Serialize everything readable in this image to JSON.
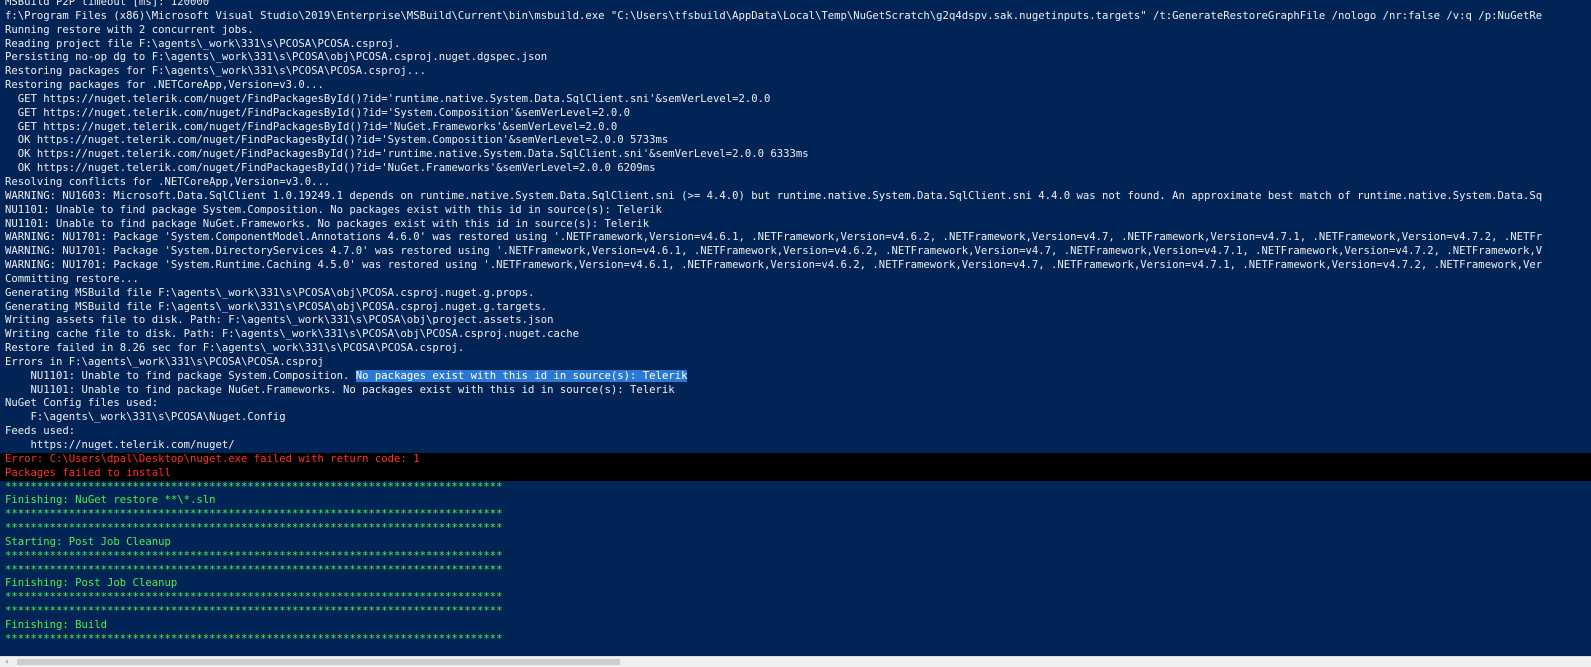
{
  "console": {
    "lines": [
      {
        "kind": "normal",
        "text": "MSBuild P2P timeout [ms]: 120000"
      },
      {
        "kind": "normal",
        "text": "f:\\Program Files (x86)\\Microsoft Visual Studio\\2019\\Enterprise\\MSBuild\\Current\\bin\\msbuild.exe \"C:\\Users\\tfsbuild\\AppData\\Local\\Temp\\NuGetScratch\\g2q4dspv.sak.nugetinputs.targets\" /t:GenerateRestoreGraphFile /nologo /nr:false /v:q /p:NuGetRe"
      },
      {
        "kind": "normal",
        "text": "Running restore with 2 concurrent jobs."
      },
      {
        "kind": "normal",
        "text": "Reading project file F:\\agents\\_work\\331\\s\\PCOSA\\PCOSA.csproj."
      },
      {
        "kind": "normal",
        "text": "Persisting no-op dg to F:\\agents\\_work\\331\\s\\PCOSA\\obj\\PCOSA.csproj.nuget.dgspec.json"
      },
      {
        "kind": "normal",
        "text": "Restoring packages for F:\\agents\\_work\\331\\s\\PCOSA\\PCOSA.csproj..."
      },
      {
        "kind": "normal",
        "text": "Restoring packages for .NETCoreApp,Version=v3.0..."
      },
      {
        "kind": "normal",
        "text": "  GET https://nuget.telerik.com/nuget/FindPackagesById()?id='runtime.native.System.Data.SqlClient.sni'&semVerLevel=2.0.0"
      },
      {
        "kind": "normal",
        "text": "  GET https://nuget.telerik.com/nuget/FindPackagesById()?id='System.Composition'&semVerLevel=2.0.0"
      },
      {
        "kind": "normal",
        "text": "  GET https://nuget.telerik.com/nuget/FindPackagesById()?id='NuGet.Frameworks'&semVerLevel=2.0.0"
      },
      {
        "kind": "normal",
        "text": "  OK https://nuget.telerik.com/nuget/FindPackagesById()?id='System.Composition'&semVerLevel=2.0.0 5733ms"
      },
      {
        "kind": "normal",
        "text": "  OK https://nuget.telerik.com/nuget/FindPackagesById()?id='runtime.native.System.Data.SqlClient.sni'&semVerLevel=2.0.0 6333ms"
      },
      {
        "kind": "normal",
        "text": "  OK https://nuget.telerik.com/nuget/FindPackagesById()?id='NuGet.Frameworks'&semVerLevel=2.0.0 6209ms"
      },
      {
        "kind": "normal",
        "text": "Resolving conflicts for .NETCoreApp,Version=v3.0..."
      },
      {
        "kind": "normal",
        "text": "WARNING: NU1603: Microsoft.Data.SqlClient 1.0.19249.1 depends on runtime.native.System.Data.SqlClient.sni (>= 4.4.0) but runtime.native.System.Data.SqlClient.sni 4.4.0 was not found. An approximate best match of runtime.native.System.Data.Sq"
      },
      {
        "kind": "normal",
        "text": "NU1101: Unable to find package System.Composition. No packages exist with this id in source(s): Telerik"
      },
      {
        "kind": "normal",
        "text": "NU1101: Unable to find package NuGet.Frameworks. No packages exist with this id in source(s): Telerik"
      },
      {
        "kind": "normal",
        "text": "WARNING: NU1701: Package 'System.ComponentModel.Annotations 4.6.0' was restored using '.NETFramework,Version=v4.6.1, .NETFramework,Version=v4.6.2, .NETFramework,Version=v4.7, .NETFramework,Version=v4.7.1, .NETFramework,Version=v4.7.2, .NETFr"
      },
      {
        "kind": "normal",
        "text": "WARNING: NU1701: Package 'System.DirectoryServices 4.7.0' was restored using '.NETFramework,Version=v4.6.1, .NETFramework,Version=v4.6.2, .NETFramework,Version=v4.7, .NETFramework,Version=v4.7.1, .NETFramework,Version=v4.7.2, .NETFramework,V"
      },
      {
        "kind": "normal",
        "text": "WARNING: NU1701: Package 'System.Runtime.Caching 4.5.0' was restored using '.NETFramework,Version=v4.6.1, .NETFramework,Version=v4.6.2, .NETFramework,Version=v4.7, .NETFramework,Version=v4.7.1, .NETFramework,Version=v4.7.2, .NETFramework,Ver"
      },
      {
        "kind": "normal",
        "text": "Committing restore..."
      },
      {
        "kind": "normal",
        "text": "Generating MSBuild file F:\\agents\\_work\\331\\s\\PCOSA\\obj\\PCOSA.csproj.nuget.g.props."
      },
      {
        "kind": "normal",
        "text": "Generating MSBuild file F:\\agents\\_work\\331\\s\\PCOSA\\obj\\PCOSA.csproj.nuget.g.targets."
      },
      {
        "kind": "normal",
        "text": "Writing assets file to disk. Path: F:\\agents\\_work\\331\\s\\PCOSA\\obj\\project.assets.json"
      },
      {
        "kind": "normal",
        "text": "Writing cache file to disk. Path: F:\\agents\\_work\\331\\s\\PCOSA\\obj\\PCOSA.csproj.nuget.cache"
      },
      {
        "kind": "normal",
        "text": "Restore failed in 8.26 sec for F:\\agents\\_work\\331\\s\\PCOSA\\PCOSA.csproj."
      },
      {
        "kind": "normal",
        "text": "Errors in F:\\agents\\_work\\331\\s\\PCOSA\\PCOSA.csproj"
      },
      {
        "kind": "normal",
        "text": "    NU1101: Unable to find package System.Composition. ",
        "selected": "No packages exist with this id in source(s): Telerik"
      },
      {
        "kind": "normal",
        "text": "    NU1101: Unable to find package NuGet.Frameworks. No packages exist with this id in source(s): Telerik"
      },
      {
        "kind": "normal",
        "text": "NuGet Config files used:"
      },
      {
        "kind": "normal",
        "text": "    F:\\agents\\_work\\331\\s\\PCOSA\\Nuget.Config"
      },
      {
        "kind": "normal",
        "text": "Feeds used:"
      },
      {
        "kind": "normal",
        "text": "    https://nuget.telerik.com/nuget/"
      },
      {
        "kind": "error",
        "text": "Error: C:\\Users\\dpal\\Desktop\\nuget.exe failed with return code: 1"
      },
      {
        "kind": "error",
        "text": "Packages failed to install"
      },
      {
        "kind": "green",
        "text": "******************************************************************************"
      },
      {
        "kind": "green",
        "text": "Finishing: NuGet restore **\\*.sln"
      },
      {
        "kind": "green",
        "text": "******************************************************************************"
      },
      {
        "kind": "green",
        "text": "******************************************************************************"
      },
      {
        "kind": "green",
        "text": "Starting: Post Job Cleanup"
      },
      {
        "kind": "green",
        "text": "******************************************************************************"
      },
      {
        "kind": "green",
        "text": "******************************************************************************"
      },
      {
        "kind": "green",
        "text": "Finishing: Post Job Cleanup"
      },
      {
        "kind": "green",
        "text": "******************************************************************************"
      },
      {
        "kind": "green",
        "text": "******************************************************************************"
      },
      {
        "kind": "green",
        "text": "Finishing: Build"
      },
      {
        "kind": "green",
        "text": "******************************************************************************"
      }
    ]
  },
  "scrollbar": {
    "left_arrow_glyph": "‹"
  },
  "colors": {
    "background": "#012456",
    "text": "#eeedf0",
    "error": "#ff3030",
    "success": "#4cf04c",
    "selection": "#2a78d4"
  }
}
